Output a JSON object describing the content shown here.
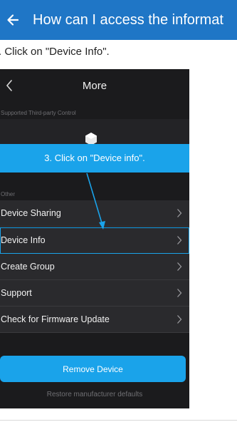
{
  "appbar": {
    "title": "How can I access the informat",
    "back_icon": "arrow-left-icon",
    "color": "#1f76c6"
  },
  "instruction": ". Click on \"Device Info\".",
  "phone": {
    "header_title": "More",
    "section_third_party": "Supported Third-party Control",
    "callout": "3. Click on \"Device info\".",
    "section_other": "Other",
    "rows": [
      {
        "label": "Device Sharing"
      },
      {
        "label": "Device Info"
      },
      {
        "label": "Create Group"
      },
      {
        "label": "Support"
      },
      {
        "label": "Check for Firmware Update"
      }
    ],
    "remove_button": "Remove Device",
    "restore_text": "Restore manufacturer defaults",
    "accent": "#1aa3ea"
  }
}
